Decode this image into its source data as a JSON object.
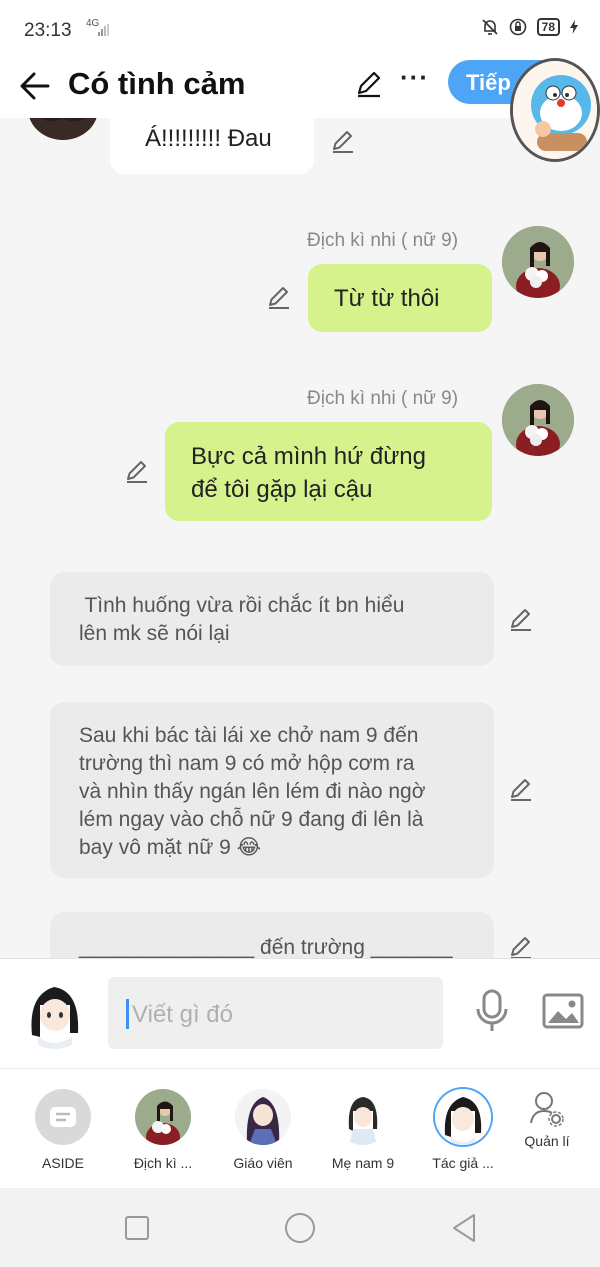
{
  "status": {
    "time": "23:13",
    "network": "4G",
    "battery": "78"
  },
  "header": {
    "title": "Có tình cảm",
    "next_label": "Tiếp"
  },
  "messages": [
    {
      "text": "Á!!!!!!!!!  Đau"
    },
    {
      "sender": "Địch kì nhi ( nữ 9)",
      "text": "Từ từ thôi"
    },
    {
      "sender": "Địch kì nhi ( nữ 9)",
      "text_line1": "Bực cả mình hứ đừng",
      "text_line2": "để tôi gặp lại cậu"
    },
    {
      "text_line1": " Tình huống vừa rồi chắc ít bn hiểu",
      "text_line2": "lên mk sẽ nói lại"
    },
    {
      "line1": "Sau khi bác tài lái xe chở nam 9 đến",
      "line2": "trường thì nam 9 có mở hộp cơm ra",
      "line3": "và nhìn thấy ngán lên lém đi nào ngờ",
      "line4": "lém ngay vào chỗ nữ 9 đang đi lên là",
      "line5": "bay vô mặt nữ 9 😂"
    },
    {
      "text": "_______________ đến trường _______"
    }
  ],
  "input": {
    "placeholder": "Viết gì đó"
  },
  "characters": [
    {
      "label": "ASIDE"
    },
    {
      "label": "Địch kì ..."
    },
    {
      "label": "Giáo viên"
    },
    {
      "label": "Mẹ nam 9"
    },
    {
      "label": "Tác giả ..."
    },
    {
      "label": "Quản lí"
    }
  ],
  "colors": {
    "accent": "#4ea4f5",
    "green_bubble": "#d6f28c",
    "grey_bubble": "#ebebeb"
  }
}
